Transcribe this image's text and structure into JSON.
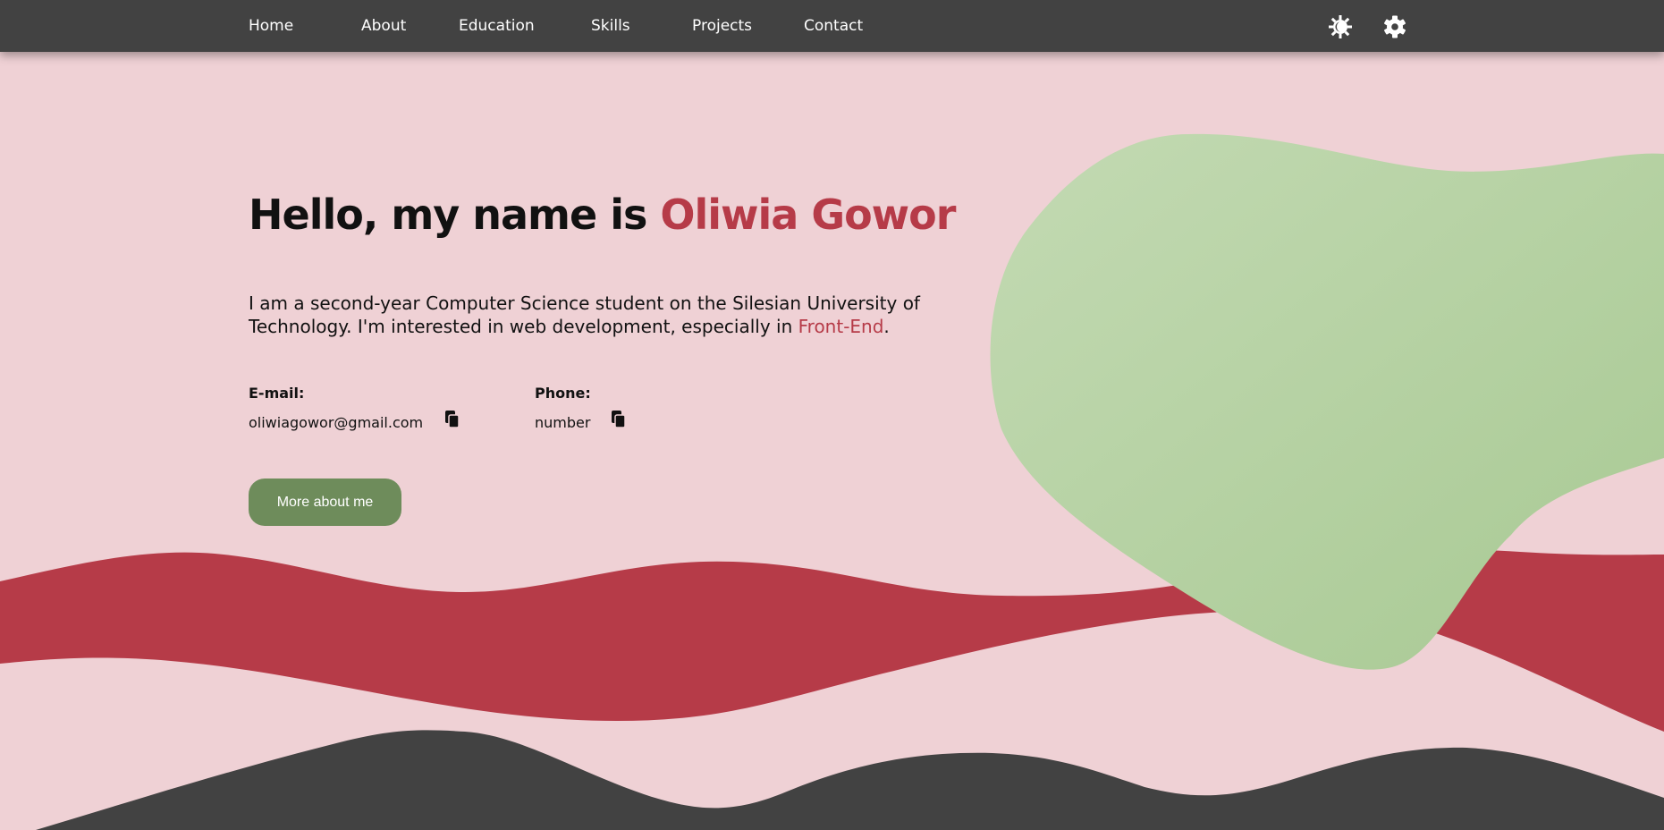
{
  "nav": {
    "links": [
      "Home",
      "About",
      "Education",
      "Skills",
      "Projects",
      "Contact"
    ],
    "icons": [
      "theme-toggle-icon",
      "settings-gear-icon"
    ]
  },
  "hero": {
    "title_prefix": "Hello, my name is ",
    "title_name": "Oliwia Gowor",
    "intro_text": "I am a second-year Computer Science student on the Silesian University of Technology. I'm interested in web development, especially in ",
    "intro_highlight": "Front-End",
    "intro_end": "."
  },
  "contact": {
    "email_label": "E-mail:",
    "email_value": "oliwiagowor@gmail.com",
    "phone_label": "Phone:",
    "phone_value": "number",
    "copy_icon": "copy-icon"
  },
  "button": {
    "label": "More about me"
  },
  "colors": {
    "background": "#efd1d5",
    "navbar": "#424242",
    "accent": "#b63b48",
    "blob": "#b5d4a2",
    "button": "#6e8c5b",
    "dark_wave": "#424242"
  }
}
